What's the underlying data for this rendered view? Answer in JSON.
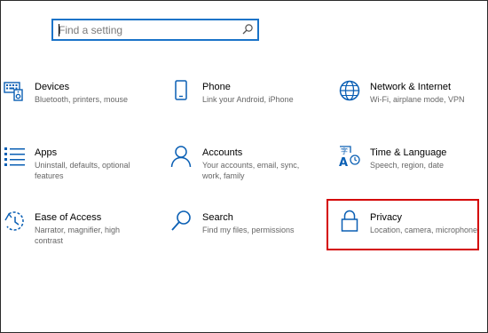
{
  "search": {
    "placeholder": "Find a setting",
    "icon": "search-icon"
  },
  "tiles": [
    {
      "title": "Devices",
      "desc": "Bluetooth, printers, mouse",
      "icon": "keyboard-speaker-icon"
    },
    {
      "title": "Phone",
      "desc": "Link your Android, iPhone",
      "icon": "phone-icon"
    },
    {
      "title": "Network & Internet",
      "desc": "Wi-Fi, airplane mode, VPN",
      "icon": "globe-icon"
    },
    {
      "title": "Apps",
      "desc": "Uninstall, defaults, optional features",
      "icon": "apps-list-icon"
    },
    {
      "title": "Accounts",
      "desc": "Your accounts, email, sync, work, family",
      "icon": "person-icon"
    },
    {
      "title": "Time & Language",
      "desc": "Speech, region, date",
      "icon": "time-language-icon"
    },
    {
      "title": "Ease of Access",
      "desc": "Narrator, magnifier, high contrast",
      "icon": "ease-of-access-icon"
    },
    {
      "title": "Search",
      "desc": "Find my files, permissions",
      "icon": "magnifier-icon"
    },
    {
      "title": "Privacy",
      "desc": "Location, camera, microphone",
      "icon": "lock-icon"
    }
  ],
  "colors": {
    "accent": "#0a5fb4",
    "highlight": "#d40000",
    "search_border": "#1a73c8"
  }
}
